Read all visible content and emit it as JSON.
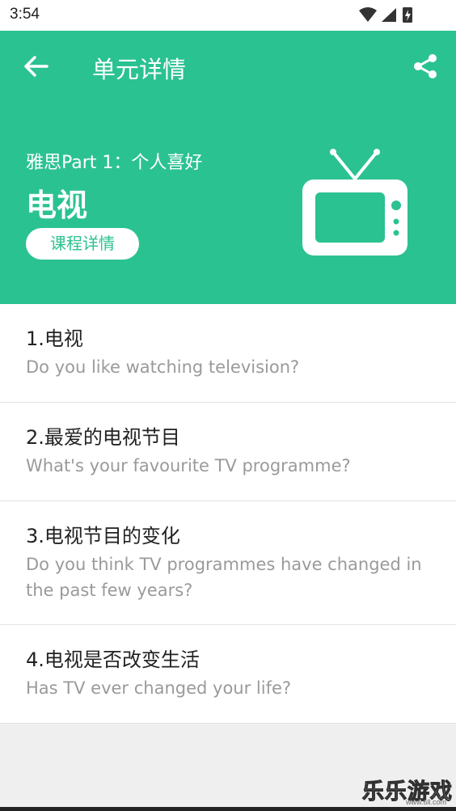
{
  "status_bar": {
    "time": "3:54"
  },
  "header": {
    "title": "单元详情",
    "subtitle": "雅思Part 1：个人喜好",
    "unit_title": "电视",
    "course_button": "课程详情"
  },
  "list": {
    "items": [
      {
        "title": "1.电视",
        "subtitle": "Do you like watching television?"
      },
      {
        "title": "2.最爱的电视节目",
        "subtitle": "What's your favourite TV programme?"
      },
      {
        "title": "3.电视节目的变化",
        "subtitle": "Do you think TV programmes have changed in the past few years?"
      },
      {
        "title": "4.电视是否改变生活",
        "subtitle": "Has TV ever changed your life?"
      }
    ]
  },
  "watermark": {
    "text": "乐乐游戏",
    "url": "www.6ll.com"
  },
  "colors": {
    "accent": "#2bc291",
    "background": "#efefef"
  },
  "icons": [
    "back-arrow-icon",
    "share-icon",
    "tv-icon",
    "wifi-icon",
    "signal-icon",
    "battery-icon"
  ]
}
